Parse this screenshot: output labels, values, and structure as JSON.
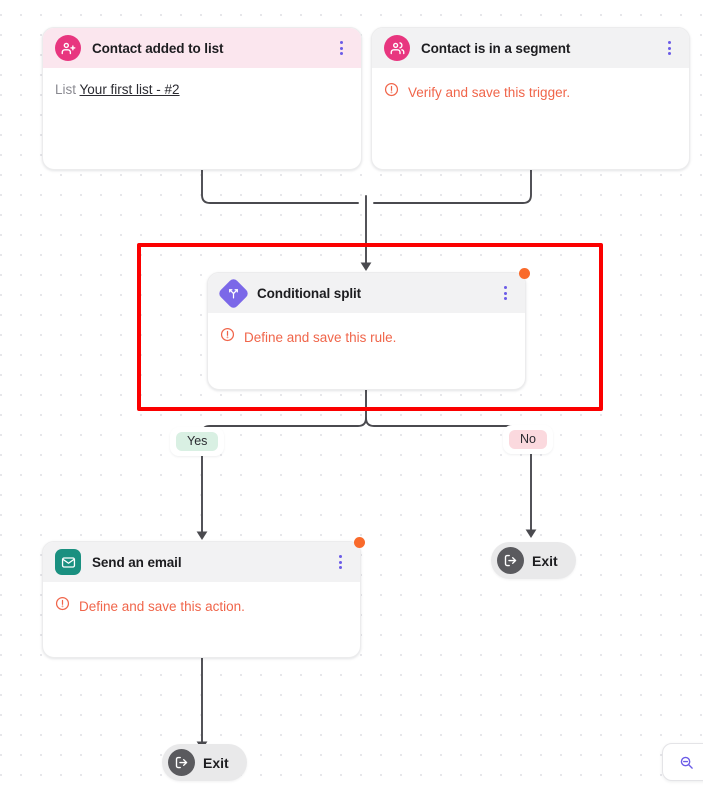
{
  "canvas": {
    "background": "#ffffff",
    "dot_color": "#e6e6ea",
    "annotation_color": "#fb0000"
  },
  "nodes": {
    "trigger_list": {
      "title": "Contact added to list",
      "icon": "contact-add-icon",
      "header_color": "#fbe6ee",
      "icon_color": "#e8367f",
      "detail_label": "List",
      "detail_value": "Your first list - #2",
      "menu": "kebab-menu-icon"
    },
    "trigger_segment": {
      "title": "Contact is in a segment",
      "icon": "contact-group-icon",
      "header_color": "#f2f2f3",
      "icon_color": "#e8367f",
      "warning": "Verify and save this trigger.",
      "warning_color": "#f0654a",
      "menu": "kebab-menu-icon"
    },
    "conditional_split": {
      "title": "Conditional split",
      "icon": "split-branch-icon",
      "header_color": "#f2f2f3",
      "icon_color": "#7b68e8",
      "warning": "Define and save this rule.",
      "warning_color": "#f0654a",
      "menu": "kebab-menu-icon",
      "badge": "unsaved-indicator"
    },
    "send_email": {
      "title": "Send an email",
      "icon": "envelope-icon",
      "header_color": "#f2f2f3",
      "icon_color": "#1a9080",
      "warning": "Define and save this action.",
      "warning_color": "#f0654a",
      "menu": "kebab-menu-icon",
      "badge": "unsaved-indicator"
    },
    "exit_yes": {
      "label": "Exit",
      "icon": "exit-arrow-icon"
    },
    "exit_no": {
      "label": "Exit",
      "icon": "exit-arrow-icon"
    }
  },
  "branches": {
    "yes": {
      "label": "Yes",
      "pill_color": "#d9f0e3"
    },
    "no": {
      "label": "No",
      "pill_color": "#fbd9de"
    }
  },
  "controls": {
    "zoom_out": "zoom-out-icon",
    "zoom_out_color": "#6b5ce7"
  }
}
